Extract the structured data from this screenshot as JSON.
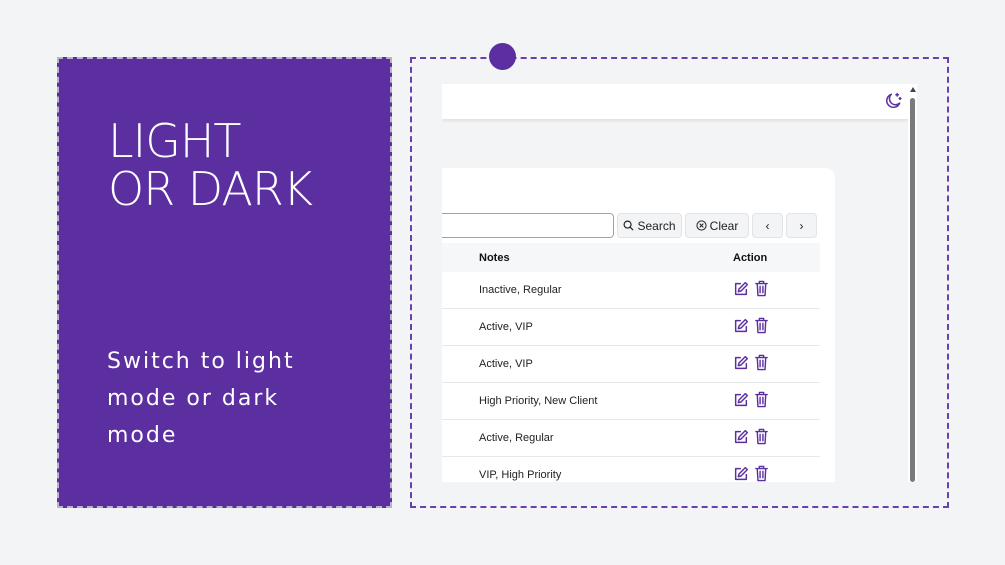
{
  "promo": {
    "title_line1": "Light",
    "title_line2": "or Dark",
    "description": "Switch to light mode or dark mode"
  },
  "app": {
    "theme_toggle_icon": "moon-stars-icon",
    "toolbar": {
      "search_value": "",
      "search_label": "Search",
      "clear_label": "Clear",
      "prev_label": "‹",
      "next_label": "›"
    },
    "table": {
      "columns": [
        "Notes",
        "Action"
      ],
      "rows": [
        {
          "notes": "Inactive, Regular"
        },
        {
          "notes": "Active, VIP"
        },
        {
          "notes": "Active, VIP"
        },
        {
          "notes": "High Priority, New Client"
        },
        {
          "notes": "Active, Regular"
        },
        {
          "notes": "VIP, High Priority"
        }
      ]
    }
  },
  "colors": {
    "accent": "#5c2fa1",
    "background": "#f3f4f6"
  }
}
